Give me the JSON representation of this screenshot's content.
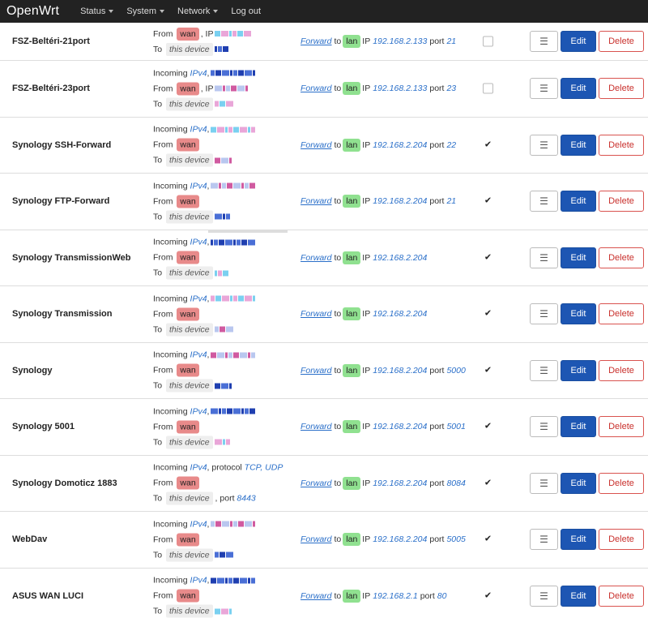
{
  "nav": {
    "brand": "OpenWrt",
    "items": [
      {
        "label": "Status",
        "dropdown": true
      },
      {
        "label": "System",
        "dropdown": true
      },
      {
        "label": "Network",
        "dropdown": true
      },
      {
        "label": "Log out",
        "dropdown": false
      }
    ]
  },
  "labels": {
    "incoming": "Incoming",
    "ipv4": "IPv4",
    "from": "From",
    "to": "To",
    "this_device": "this device",
    "forward": "Forward",
    "to_word": "to",
    "ip": "IP",
    "port": "port",
    "protocol": "protocol",
    "drag_icon": "☰",
    "edit": "Edit",
    "delete": "Delete"
  },
  "colors": {
    "wan": "#e88a8a",
    "lan": "#90e190",
    "edit": "#1d56b3",
    "delete": "#d9534f",
    "link": "#2a6fc9"
  },
  "rules": [
    {
      "name": "FSZ-Beltéri-21port",
      "incoming": false,
      "from_zone": "wan",
      "from_ip": true,
      "to_port": "",
      "protocol": "",
      "dest_zone": "lan",
      "dest_ip": "192.168.2.133",
      "dest_port": "21",
      "enabled": false
    },
    {
      "name": "FSZ-Beltéri-23port",
      "incoming": true,
      "from_zone": "wan",
      "from_ip": true,
      "to_port": "",
      "protocol": "",
      "dest_zone": "lan",
      "dest_ip": "192.168.2.133",
      "dest_port": "23",
      "enabled": false
    },
    {
      "name": "Synology SSH-Forward",
      "incoming": true,
      "from_zone": "wan",
      "from_ip": false,
      "to_port": "",
      "protocol": "",
      "dest_zone": "lan",
      "dest_ip": "192.168.2.204",
      "dest_port": "22",
      "enabled": true
    },
    {
      "name": "Synology FTP-Forward",
      "incoming": true,
      "from_zone": "wan",
      "from_ip": false,
      "to_port": "",
      "protocol": "",
      "dest_zone": "lan",
      "dest_ip": "192.168.2.204",
      "dest_port": "21",
      "enabled": true
    },
    {
      "name": "Synology TransmissionWeb",
      "incoming": true,
      "from_zone": "wan",
      "from_ip": false,
      "to_port": "",
      "protocol": "",
      "dest_zone": "lan",
      "dest_ip": "192.168.2.204",
      "dest_port": "",
      "enabled": true
    },
    {
      "name": "Synology Transmission",
      "incoming": true,
      "from_zone": "wan",
      "from_ip": false,
      "to_port": "",
      "protocol": "",
      "dest_zone": "lan",
      "dest_ip": "192.168.2.204",
      "dest_port": "",
      "enabled": true
    },
    {
      "name": "Synology",
      "incoming": true,
      "from_zone": "wan",
      "from_ip": false,
      "to_port": "",
      "protocol": "",
      "dest_zone": "lan",
      "dest_ip": "192.168.2.204",
      "dest_port": "5000",
      "enabled": true
    },
    {
      "name": "Synology 5001",
      "incoming": true,
      "from_zone": "wan",
      "from_ip": false,
      "to_port": "",
      "protocol": "",
      "dest_zone": "lan",
      "dest_ip": "192.168.2.204",
      "dest_port": "5001",
      "enabled": true
    },
    {
      "name": "Synology Domoticz 1883",
      "incoming": true,
      "from_zone": "wan",
      "from_ip": false,
      "to_port": "8443",
      "protocol": "TCP, UDP",
      "dest_zone": "lan",
      "dest_ip": "192.168.2.204",
      "dest_port": "8084",
      "enabled": true
    },
    {
      "name": "WebDav",
      "incoming": true,
      "from_zone": "wan",
      "from_ip": false,
      "to_port": "",
      "protocol": "",
      "dest_zone": "lan",
      "dest_ip": "192.168.2.204",
      "dest_port": "5005",
      "enabled": true
    },
    {
      "name": "ASUS WAN LUCI",
      "incoming": true,
      "from_zone": "wan",
      "from_ip": false,
      "to_port": "",
      "protocol": "",
      "dest_zone": "lan",
      "dest_ip": "192.168.2.1",
      "dest_port": "80",
      "enabled": true
    }
  ]
}
